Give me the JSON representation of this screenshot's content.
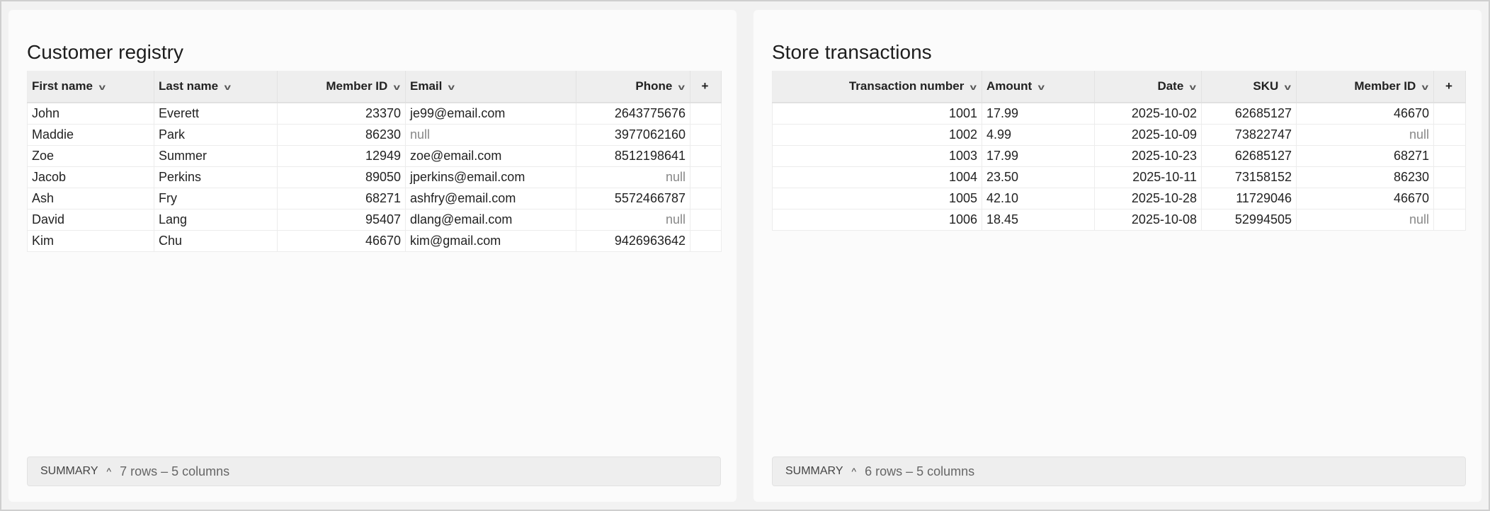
{
  "panels": [
    {
      "title": "Customer registry",
      "columns": [
        {
          "label": "First name",
          "align": "l"
        },
        {
          "label": "Last name",
          "align": "l"
        },
        {
          "label": "Member ID",
          "align": "r"
        },
        {
          "label": "Email",
          "align": "l"
        },
        {
          "label": "Phone",
          "align": "r"
        }
      ],
      "rows": [
        [
          "John",
          "Everett",
          "23370",
          "je99@email.com",
          "2643775676"
        ],
        [
          "Maddie",
          "Park",
          "86230",
          "null",
          "3977062160"
        ],
        [
          "Zoe",
          "Summer",
          "12949",
          "zoe@email.com",
          "8512198641"
        ],
        [
          "Jacob",
          "Perkins",
          "89050",
          "jperkins@email.com",
          "null"
        ],
        [
          "Ash",
          "Fry",
          "68271",
          "ashfry@email.com",
          "5572466787"
        ],
        [
          "David",
          "Lang",
          "95407",
          "dlang@email.com",
          "null"
        ],
        [
          "Kim",
          "Chu",
          "46670",
          "kim@gmail.com",
          "9426963642"
        ]
      ],
      "add_column": "+",
      "summary_label": "SUMMARY",
      "summary_count": "7 rows – 5 columns"
    },
    {
      "title": "Store transactions",
      "columns": [
        {
          "label": "Transaction number",
          "align": "r"
        },
        {
          "label": "Amount",
          "align": "l"
        },
        {
          "label": "Date",
          "align": "r"
        },
        {
          "label": "SKU",
          "align": "r"
        },
        {
          "label": "Member ID",
          "align": "r"
        }
      ],
      "rows": [
        [
          "1001",
          "17.99",
          "2025-10-02",
          "62685127",
          "46670"
        ],
        [
          "1002",
          "4.99",
          "2025-10-09",
          "73822747",
          "null"
        ],
        [
          "1003",
          "17.99",
          "2025-10-23",
          "62685127",
          "68271"
        ],
        [
          "1004",
          "23.50",
          "2025-10-11",
          "73158152",
          "86230"
        ],
        [
          "1005",
          "42.10",
          "2025-10-28",
          "11729046",
          "46670"
        ],
        [
          "1006",
          "18.45",
          "2025-10-08",
          "52994505",
          "null"
        ]
      ],
      "add_column": "+",
      "summary_label": "SUMMARY",
      "summary_count": "6 rows – 5 columns"
    }
  ]
}
